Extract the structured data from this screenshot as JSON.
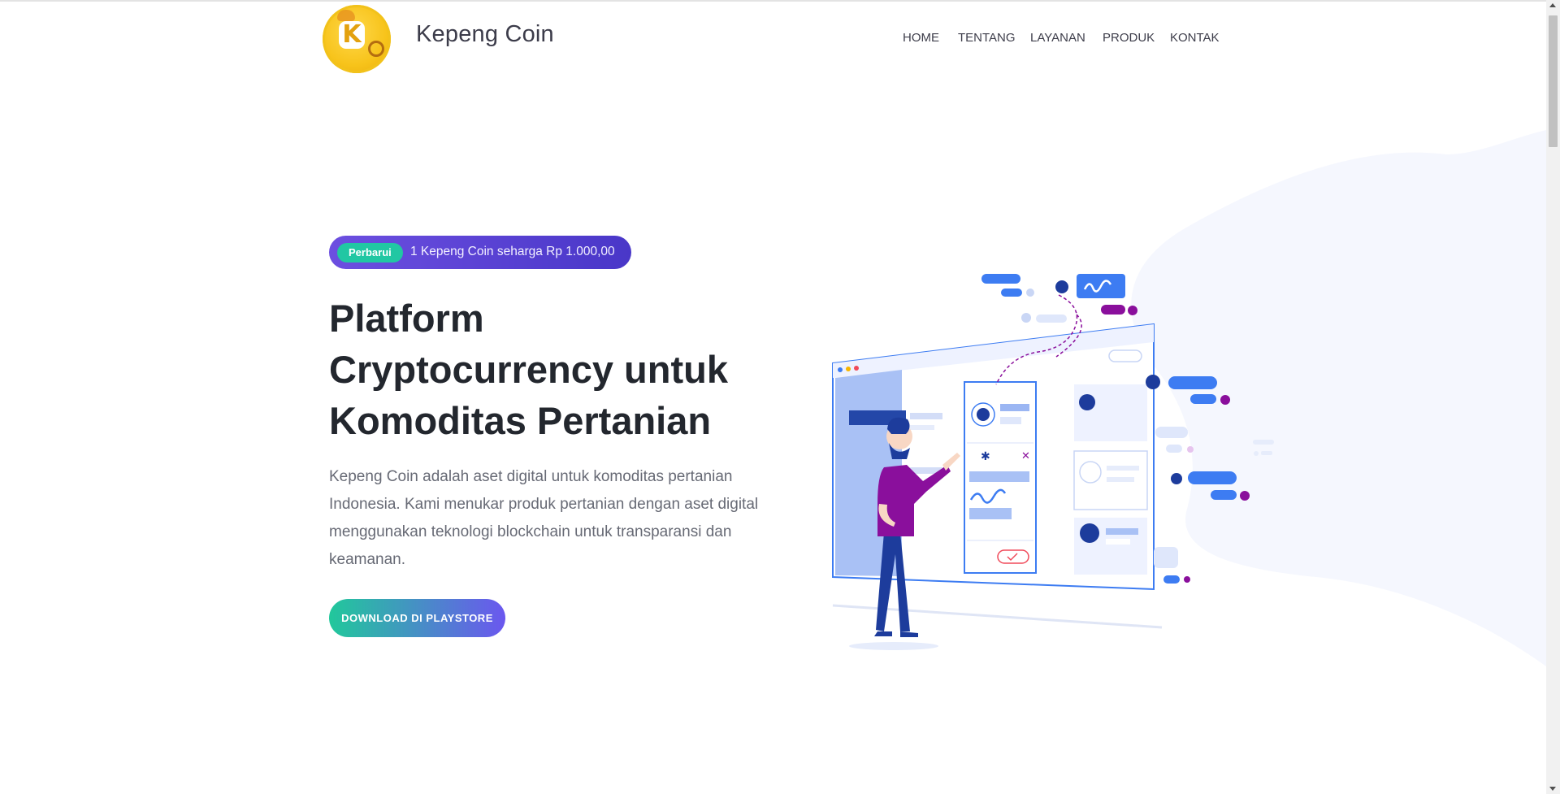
{
  "header": {
    "brand": "Kepeng Coin",
    "nav": [
      {
        "label": "HOME"
      },
      {
        "label": "TENTANG"
      },
      {
        "label": "LAYANAN"
      },
      {
        "label": "PRODUK"
      },
      {
        "label": "KONTAK"
      }
    ]
  },
  "hero": {
    "badge": "Perbarui",
    "notice": "1 Kepeng Coin seharga Rp 1.000,00",
    "title_lines": [
      "Platform",
      "Cryptocurrency untuk",
      "Komoditas Pertanian"
    ],
    "description": "Kepeng Coin adalah aset digital untuk komoditas pertanian Indonesia. Kami menukar produk pertanian dengan aset digital menggunakan teknologi blockchain untuk transparansi dan keamanan.",
    "cta_label": "DOWNLOAD DI PLAYSTORE"
  },
  "colors": {
    "accent_purple": "#5a44d6",
    "accent_teal": "#21c7a3",
    "illustration_blue": "#3d7cf2",
    "illustration_magenta": "#8a0f9c"
  },
  "icons": {
    "logo": "kepeng-coin-logo",
    "illustration": "person-presenting-dashboard"
  }
}
